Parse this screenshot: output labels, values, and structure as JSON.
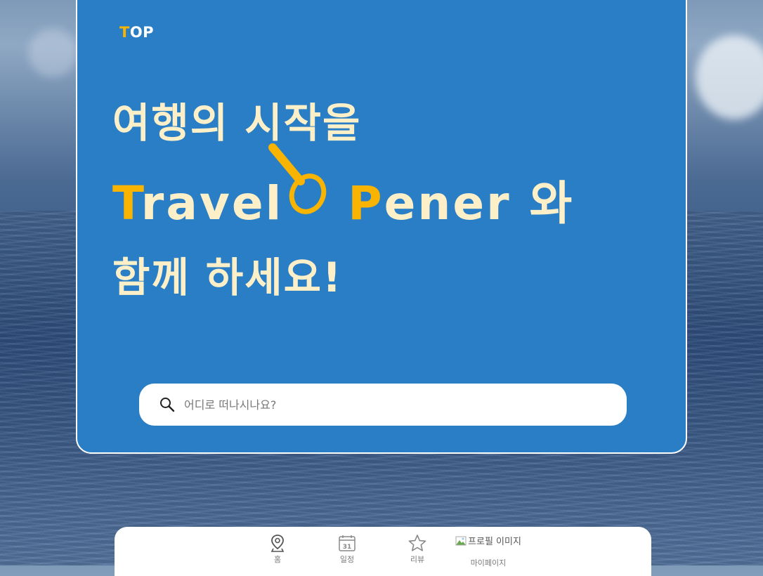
{
  "brand": {
    "logo_accent": "T",
    "logo_rest": "OP"
  },
  "hero": {
    "line1": "여행의 시작을",
    "line2_t": "T",
    "line2_ravel": "ravel ",
    "line2_p": "P",
    "line2_ener": "ener 와",
    "line3": "함께 하세요!"
  },
  "search": {
    "placeholder": "어디로 떠나시나요?",
    "value": ""
  },
  "nav": {
    "items": [
      {
        "label": "홈",
        "icon": "map-pin-icon"
      },
      {
        "label": "일정",
        "icon": "calendar-icon"
      },
      {
        "label": "리뷰",
        "icon": "star-icon"
      },
      {
        "label": "마이페이지",
        "icon": "profile-image"
      }
    ],
    "calendar_day": "31",
    "profile_alt": "프로필 이미지"
  },
  "colors": {
    "accent": "#f8b400",
    "card": "#2a7ec6",
    "headline": "#fdf0c8"
  }
}
